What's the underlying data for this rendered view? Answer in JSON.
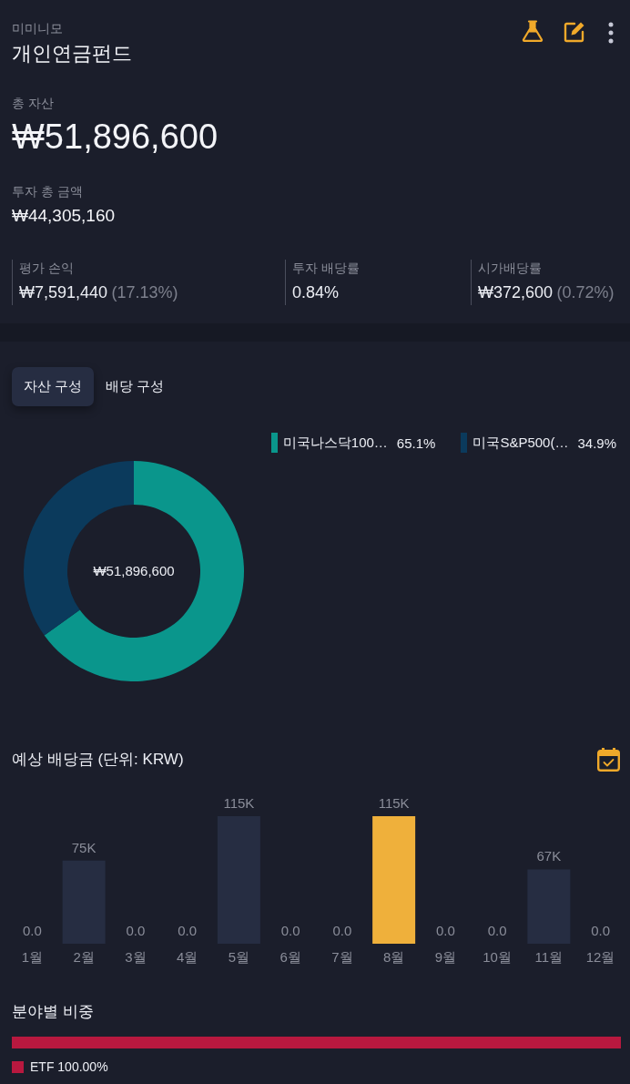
{
  "header": {
    "account": "미미니모",
    "title": "개인연금펀드"
  },
  "total_assets": {
    "label": "총 자산",
    "value": "₩51,896,600"
  },
  "invested": {
    "label": "투자 총 금액",
    "value": "₩44,305,160"
  },
  "metrics": [
    {
      "label": "평가 손익",
      "value": "₩7,591,440",
      "note": "(17.13%)"
    },
    {
      "label": "투자 배당률",
      "value": "0.84%"
    },
    {
      "label": "시가배당률",
      "value": "₩372,600",
      "note": "(0.72%)"
    }
  ],
  "allocation": {
    "tabs": [
      {
        "label": "자산 구성",
        "selected": true
      },
      {
        "label": "배당 구성",
        "selected": false
      }
    ],
    "legend": [
      {
        "share": "65.1%",
        "color": "#0a968c"
      },
      {
        "share": "34.9%",
        "color": "#0b3a5c"
      }
    ],
    "center_label": "₩51,896,600",
    "chart_data": {
      "type": "donut",
      "categories": [
        "미국나스닥100…",
        "미국S&P500(…"
      ],
      "values": [
        65.1,
        34.9
      ]
    }
  },
  "dividends": {
    "title": "예상 배당금 (단위: KRW)",
    "bars": [
      {
        "selected": false
      },
      {
        "selected": false
      },
      {
        "selected": false
      },
      {
        "selected": false
      },
      {
        "selected": false
      },
      {
        "selected": false
      },
      {
        "selected": false
      },
      {
        "selected": true
      },
      {
        "selected": false
      },
      {
        "selected": false
      },
      {
        "selected": false
      },
      {
        "selected": false
      }
    ],
    "chart_data": {
      "type": "bar",
      "categories": [
        "1월",
        "2월",
        "3월",
        "4월",
        "5월",
        "6월",
        "7월",
        "8월",
        "9월",
        "10월",
        "11월",
        "12월"
      ],
      "values": [
        0,
        75000,
        0,
        0,
        115000,
        0,
        0,
        115000,
        0,
        0,
        67000,
        0
      ],
      "value_labels": [
        "0.0",
        "75K",
        "0.0",
        "0.0",
        "115K",
        "0.0",
        "0.0",
        "115K",
        "0.0",
        "0.0",
        "67K",
        "0.0"
      ],
      "ylim": [
        0,
        115000
      ]
    }
  },
  "sectors": {
    "title": "분야별 비중",
    "items": [
      {
        "label": "ETF 100.00%",
        "color": "#b8183f"
      }
    ]
  }
}
